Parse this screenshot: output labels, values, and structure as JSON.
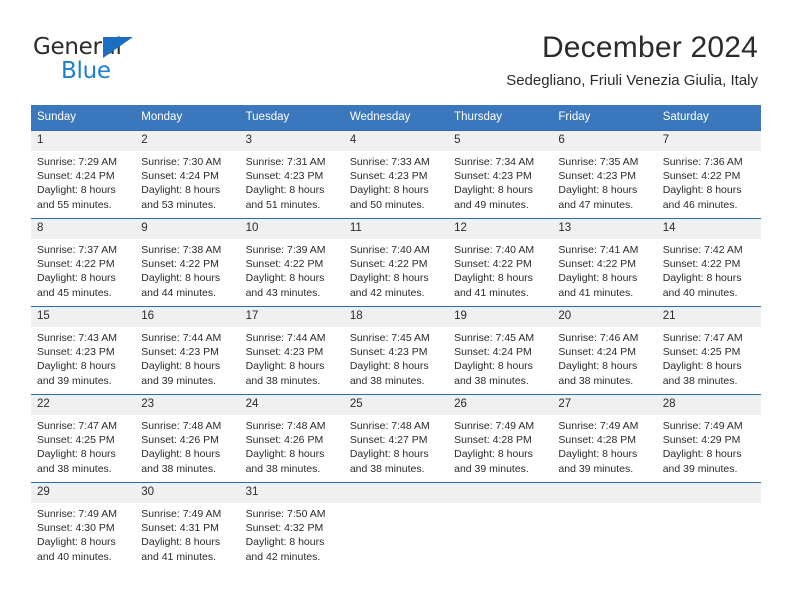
{
  "brand": {
    "name_part1": "General",
    "name_part2": "Blue",
    "triangle_color": "#1b6ec2",
    "blue_color": "#1b7fd4"
  },
  "header": {
    "title": "December 2024",
    "subtitle": "Sedegliano, Friuli Venezia Giulia, Italy"
  },
  "theme": {
    "header_bg": "#3b77bc",
    "row_border": "#2f6daf",
    "daynum_bg": "#f0f0f0"
  },
  "calendar": {
    "weekdays": [
      "Sunday",
      "Monday",
      "Tuesday",
      "Wednesday",
      "Thursday",
      "Friday",
      "Saturday"
    ],
    "weeks": [
      [
        {
          "day": "1",
          "sunrise": "Sunrise: 7:29 AM",
          "sunset": "Sunset: 4:24 PM",
          "daylight1": "Daylight: 8 hours",
          "daylight2": "and 55 minutes."
        },
        {
          "day": "2",
          "sunrise": "Sunrise: 7:30 AM",
          "sunset": "Sunset: 4:24 PM",
          "daylight1": "Daylight: 8 hours",
          "daylight2": "and 53 minutes."
        },
        {
          "day": "3",
          "sunrise": "Sunrise: 7:31 AM",
          "sunset": "Sunset: 4:23 PM",
          "daylight1": "Daylight: 8 hours",
          "daylight2": "and 51 minutes."
        },
        {
          "day": "4",
          "sunrise": "Sunrise: 7:33 AM",
          "sunset": "Sunset: 4:23 PM",
          "daylight1": "Daylight: 8 hours",
          "daylight2": "and 50 minutes."
        },
        {
          "day": "5",
          "sunrise": "Sunrise: 7:34 AM",
          "sunset": "Sunset: 4:23 PM",
          "daylight1": "Daylight: 8 hours",
          "daylight2": "and 49 minutes."
        },
        {
          "day": "6",
          "sunrise": "Sunrise: 7:35 AM",
          "sunset": "Sunset: 4:23 PM",
          "daylight1": "Daylight: 8 hours",
          "daylight2": "and 47 minutes."
        },
        {
          "day": "7",
          "sunrise": "Sunrise: 7:36 AM",
          "sunset": "Sunset: 4:22 PM",
          "daylight1": "Daylight: 8 hours",
          "daylight2": "and 46 minutes."
        }
      ],
      [
        {
          "day": "8",
          "sunrise": "Sunrise: 7:37 AM",
          "sunset": "Sunset: 4:22 PM",
          "daylight1": "Daylight: 8 hours",
          "daylight2": "and 45 minutes."
        },
        {
          "day": "9",
          "sunrise": "Sunrise: 7:38 AM",
          "sunset": "Sunset: 4:22 PM",
          "daylight1": "Daylight: 8 hours",
          "daylight2": "and 44 minutes."
        },
        {
          "day": "10",
          "sunrise": "Sunrise: 7:39 AM",
          "sunset": "Sunset: 4:22 PM",
          "daylight1": "Daylight: 8 hours",
          "daylight2": "and 43 minutes."
        },
        {
          "day": "11",
          "sunrise": "Sunrise: 7:40 AM",
          "sunset": "Sunset: 4:22 PM",
          "daylight1": "Daylight: 8 hours",
          "daylight2": "and 42 minutes."
        },
        {
          "day": "12",
          "sunrise": "Sunrise: 7:40 AM",
          "sunset": "Sunset: 4:22 PM",
          "daylight1": "Daylight: 8 hours",
          "daylight2": "and 41 minutes."
        },
        {
          "day": "13",
          "sunrise": "Sunrise: 7:41 AM",
          "sunset": "Sunset: 4:22 PM",
          "daylight1": "Daylight: 8 hours",
          "daylight2": "and 41 minutes."
        },
        {
          "day": "14",
          "sunrise": "Sunrise: 7:42 AM",
          "sunset": "Sunset: 4:22 PM",
          "daylight1": "Daylight: 8 hours",
          "daylight2": "and 40 minutes."
        }
      ],
      [
        {
          "day": "15",
          "sunrise": "Sunrise: 7:43 AM",
          "sunset": "Sunset: 4:23 PM",
          "daylight1": "Daylight: 8 hours",
          "daylight2": "and 39 minutes."
        },
        {
          "day": "16",
          "sunrise": "Sunrise: 7:44 AM",
          "sunset": "Sunset: 4:23 PM",
          "daylight1": "Daylight: 8 hours",
          "daylight2": "and 39 minutes."
        },
        {
          "day": "17",
          "sunrise": "Sunrise: 7:44 AM",
          "sunset": "Sunset: 4:23 PM",
          "daylight1": "Daylight: 8 hours",
          "daylight2": "and 38 minutes."
        },
        {
          "day": "18",
          "sunrise": "Sunrise: 7:45 AM",
          "sunset": "Sunset: 4:23 PM",
          "daylight1": "Daylight: 8 hours",
          "daylight2": "and 38 minutes."
        },
        {
          "day": "19",
          "sunrise": "Sunrise: 7:45 AM",
          "sunset": "Sunset: 4:24 PM",
          "daylight1": "Daylight: 8 hours",
          "daylight2": "and 38 minutes."
        },
        {
          "day": "20",
          "sunrise": "Sunrise: 7:46 AM",
          "sunset": "Sunset: 4:24 PM",
          "daylight1": "Daylight: 8 hours",
          "daylight2": "and 38 minutes."
        },
        {
          "day": "21",
          "sunrise": "Sunrise: 7:47 AM",
          "sunset": "Sunset: 4:25 PM",
          "daylight1": "Daylight: 8 hours",
          "daylight2": "and 38 minutes."
        }
      ],
      [
        {
          "day": "22",
          "sunrise": "Sunrise: 7:47 AM",
          "sunset": "Sunset: 4:25 PM",
          "daylight1": "Daylight: 8 hours",
          "daylight2": "and 38 minutes."
        },
        {
          "day": "23",
          "sunrise": "Sunrise: 7:48 AM",
          "sunset": "Sunset: 4:26 PM",
          "daylight1": "Daylight: 8 hours",
          "daylight2": "and 38 minutes."
        },
        {
          "day": "24",
          "sunrise": "Sunrise: 7:48 AM",
          "sunset": "Sunset: 4:26 PM",
          "daylight1": "Daylight: 8 hours",
          "daylight2": "and 38 minutes."
        },
        {
          "day": "25",
          "sunrise": "Sunrise: 7:48 AM",
          "sunset": "Sunset: 4:27 PM",
          "daylight1": "Daylight: 8 hours",
          "daylight2": "and 38 minutes."
        },
        {
          "day": "26",
          "sunrise": "Sunrise: 7:49 AM",
          "sunset": "Sunset: 4:28 PM",
          "daylight1": "Daylight: 8 hours",
          "daylight2": "and 39 minutes."
        },
        {
          "day": "27",
          "sunrise": "Sunrise: 7:49 AM",
          "sunset": "Sunset: 4:28 PM",
          "daylight1": "Daylight: 8 hours",
          "daylight2": "and 39 minutes."
        },
        {
          "day": "28",
          "sunrise": "Sunrise: 7:49 AM",
          "sunset": "Sunset: 4:29 PM",
          "daylight1": "Daylight: 8 hours",
          "daylight2": "and 39 minutes."
        }
      ],
      [
        {
          "day": "29",
          "sunrise": "Sunrise: 7:49 AM",
          "sunset": "Sunset: 4:30 PM",
          "daylight1": "Daylight: 8 hours",
          "daylight2": "and 40 minutes."
        },
        {
          "day": "30",
          "sunrise": "Sunrise: 7:49 AM",
          "sunset": "Sunset: 4:31 PM",
          "daylight1": "Daylight: 8 hours",
          "daylight2": "and 41 minutes."
        },
        {
          "day": "31",
          "sunrise": "Sunrise: 7:50 AM",
          "sunset": "Sunset: 4:32 PM",
          "daylight1": "Daylight: 8 hours",
          "daylight2": "and 42 minutes."
        },
        {
          "day": "",
          "sunrise": "",
          "sunset": "",
          "daylight1": "",
          "daylight2": ""
        },
        {
          "day": "",
          "sunrise": "",
          "sunset": "",
          "daylight1": "",
          "daylight2": ""
        },
        {
          "day": "",
          "sunrise": "",
          "sunset": "",
          "daylight1": "",
          "daylight2": ""
        },
        {
          "day": "",
          "sunrise": "",
          "sunset": "",
          "daylight1": "",
          "daylight2": ""
        }
      ]
    ]
  }
}
